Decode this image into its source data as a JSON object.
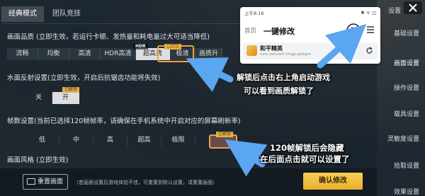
{
  "tabs": [
    {
      "label": "经典模式",
      "active": true
    },
    {
      "label": "团队竞技",
      "active": false
    }
  ],
  "quality": {
    "title": "画面品质 (立即生效，若运行卡顿、发热量和耗电量过大可适当降低)",
    "options": [
      "流畅",
      "均衡",
      "高清",
      "HDR高清",
      "超高清",
      "极清",
      "画质升"
    ],
    "hdr_tag": "HDR",
    "badge": "已解锁",
    "selected": "超高清"
  },
  "water": {
    "title": "水面反射设置(立即生效，开启后抗锯齿功能将失效)",
    "options": [
      "关",
      "开"
    ],
    "badge": "已解锁",
    "selected": "开"
  },
  "framerate": {
    "title": "帧数设置(当前已选择120帧帧率，请确保在手机系统中开启对应的屏幕刷新率)",
    "options": [
      "低",
      "中",
      "高",
      "超高",
      "极限"
    ],
    "badge": "已解锁"
  },
  "style": {
    "title": "画面风格 (立即生效)"
  },
  "bottom": {
    "reset": "重置画面",
    "note": "（若画面设置后游戏体验不佳，可重置到默认设置，请重置画面）",
    "confirm": "确认修改"
  },
  "sidebar": {
    "items": [
      "设置",
      "基础设置",
      "画面设置",
      "操作设置",
      "载具设置",
      "灵敏度设置",
      "拾取设置",
      "效果设置"
    ],
    "active": "画面设置"
  },
  "phone": {
    "time": "上午8:16",
    "status_icons": "✱ ᯤ ◫",
    "home": "首页",
    "title": "一键修改",
    "app_name": "和平精英",
    "app_url": "com.tencent.tmgp.pubgm"
  },
  "annotations": {
    "unlock_start": "解锁后点击右上角启动游戏",
    "see_quality": "可以看到画质解锁了",
    "fps_hidden": "120帧解锁后会隐藏",
    "click_back": "在后面点击就可以设置了"
  },
  "colors": {
    "accent": "#f0a33a",
    "arrow": "#5aa6f0",
    "confirm": "#f2c040"
  }
}
